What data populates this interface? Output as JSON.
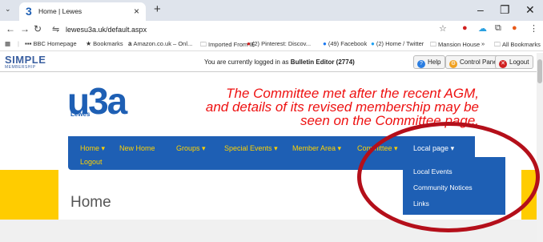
{
  "browser": {
    "tab_title": "Home | Lewes",
    "tab_favicon": "3",
    "new_tab": "+",
    "url": "lewesu3a.uk/default.aspx",
    "window_controls": [
      "–",
      "❐",
      "✕"
    ]
  },
  "bookmarks_bar": {
    "items": [
      {
        "icon": "apps-icon",
        "label": ""
      },
      {
        "icon": "bbc-icon",
        "label": "BBC Homepage"
      },
      {
        "icon": "star-icon",
        "label": "Bookmarks"
      },
      {
        "icon": "amazon-icon",
        "label": "Amazon.co.uk – Onl..."
      },
      {
        "icon": "folder-icon",
        "label": "Imported From IE"
      },
      {
        "icon": "pinterest-icon",
        "label": "(2) Pinterest: Discov..."
      },
      {
        "icon": "facebook-icon",
        "label": "(49) Facebook"
      },
      {
        "icon": "twitter-icon",
        "label": "(2) Home / Twitter"
      },
      {
        "icon": "folder-icon",
        "label": "Mansion House"
      }
    ],
    "overflow": "»",
    "all_bookmarks": "All Bookmarks"
  },
  "cms": {
    "logo_line1": "SIMPLE",
    "logo_line2": "MEMBERSHIP",
    "status_prefix": "You are currently logged in as",
    "status_user": "Bulletin Editor (2774)",
    "help_label": "Help",
    "control_panel_label": "Control Panel",
    "logout_label": "Logout"
  },
  "site": {
    "logo_text": "u3a",
    "logo_sub": "Lewes",
    "announcement_lines": [
      "The Committee met after the recent AGM,",
      "and details of its revised membership may be",
      "seen on the Committee page."
    ]
  },
  "menu": {
    "items": [
      {
        "label": "Home",
        "has_caret": true
      },
      {
        "label": "New Home",
        "has_caret": false
      },
      {
        "label": "Groups",
        "has_caret": true
      },
      {
        "label": "Special Events",
        "has_caret": true
      },
      {
        "label": "Member Area",
        "has_caret": true
      },
      {
        "label": "Committee",
        "has_caret": true
      },
      {
        "label": "Local page",
        "has_caret": true
      },
      {
        "label": "Logout",
        "has_caret": false
      }
    ],
    "dropdown": [
      "Local Events",
      "Community Notices",
      "Links"
    ]
  },
  "page": {
    "title": "Home"
  },
  "colors": {
    "brand_blue": "#1e5fb4",
    "menu_yellow": "#ffd200",
    "band_yellow": "#ffcc00",
    "announcement_red": "#e11111",
    "annotation_red": "#b40f1a"
  }
}
